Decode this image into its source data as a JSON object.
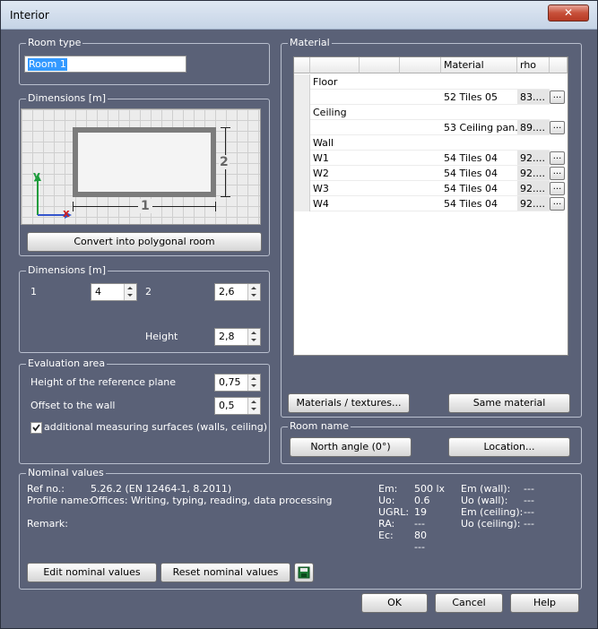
{
  "window": {
    "title": "Interior",
    "close_glyph": "✕"
  },
  "room_type": {
    "legend": "Room type",
    "value": "Room 1"
  },
  "dimensions_diagram": {
    "legend": "Dimensions [m]",
    "label_1": "1",
    "label_2": "2",
    "axis_x": "x",
    "axis_y": "y",
    "convert_button": "Convert into polygonal room"
  },
  "dimensions": {
    "legend": "Dimensions [m]",
    "dim1_label": "1",
    "dim1_value": "4",
    "dim2_label": "2",
    "dim2_value": "2,6",
    "height_label": "Height",
    "height_value": "2,8"
  },
  "evaluation": {
    "legend": "Evaluation area",
    "ref_plane_label": "Height of the reference plane",
    "ref_plane_value": "0,75",
    "offset_label": "Offset to the wall",
    "offset_value": "0,5",
    "checkbox_label": "additional measuring surfaces (walls, ceiling)",
    "checkbox_checked": true
  },
  "material": {
    "legend": "Material",
    "columns": [
      "",
      "",
      "Material",
      "rho"
    ],
    "rows": [
      {
        "name": "Floor",
        "material": "",
        "rho": "",
        "button": false
      },
      {
        "name": "",
        "material": "52 Tiles 05",
        "rho": "83....",
        "button": true
      },
      {
        "name": "Ceiling",
        "material": "",
        "rho": "",
        "button": false
      },
      {
        "name": "",
        "material": "53 Ceiling pan...",
        "rho": "89....",
        "button": true
      },
      {
        "name": "Wall",
        "material": "",
        "rho": "",
        "button": false
      },
      {
        "name": "W1",
        "material": "54 Tiles 04",
        "rho": "92....",
        "button": true
      },
      {
        "name": "W2",
        "material": "54 Tiles 04",
        "rho": "92....",
        "button": true
      },
      {
        "name": "W3",
        "material": "54 Tiles 04",
        "rho": "92....",
        "button": true
      },
      {
        "name": "W4",
        "material": "54 Tiles 04",
        "rho": "92....",
        "button": true
      }
    ],
    "row_button_label": "...",
    "materials_button": "Materials / textures...",
    "same_button": "Same material"
  },
  "room_name": {
    "legend": "Room name",
    "north_button": "North angle (0°)",
    "location_button": "Location..."
  },
  "nominal": {
    "legend": "Nominal values",
    "ref_label": "Ref no.:",
    "ref_value": "5.26.2 (EN 12464-1, 8.2011)",
    "profile_label": "Profile name:",
    "profile_value": "Offices: Writing, typing, reading, data processing",
    "remark_label": "Remark:",
    "left_metrics": [
      {
        "label": "Em:",
        "value": "500 lx"
      },
      {
        "label": "Uo:",
        "value": "0.6"
      },
      {
        "label": "UGRL:",
        "value": "19"
      },
      {
        "label": "RA:",
        "value": "---"
      },
      {
        "label": "Ec:",
        "value": "80"
      },
      {
        "label": "",
        "value": "---"
      }
    ],
    "right_metrics": [
      {
        "label": "Em (wall):",
        "value": "---"
      },
      {
        "label": "Uo (wall):",
        "value": "---"
      },
      {
        "label": "Em (ceiling):",
        "value": "---"
      },
      {
        "label": "Uo (ceiling):",
        "value": "---"
      }
    ],
    "edit_button": "Edit nominal values",
    "reset_button": "Reset nominal values",
    "save_icon": "floppy-disk-icon"
  },
  "footer": {
    "ok": "OK",
    "cancel": "Cancel",
    "help": "Help"
  }
}
